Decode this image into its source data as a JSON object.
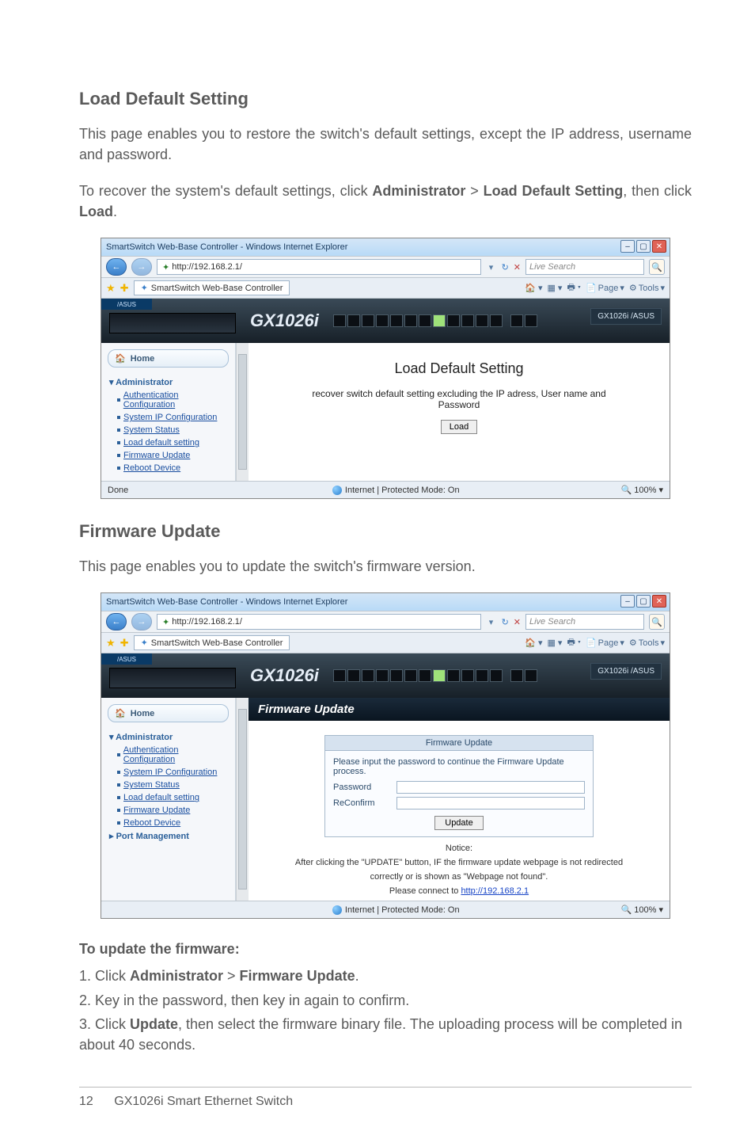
{
  "sections": {
    "load_default": {
      "heading": "Load Default Setting",
      "p1_a": "This page enables you to restore the switch's default settings, except the IP address, username and password.",
      "p2_pre": "To recover the system's default settings, click ",
      "p2_b1": "Administrator",
      "p2_gt": " > ",
      "p2_b2": "Load Default Setting",
      "p2_mid": ", then click ",
      "p2_b3": "Load",
      "p2_end": "."
    },
    "firmware_update": {
      "heading": "Firmware Update",
      "p1": "This page enables you to update the switch's firmware version.",
      "sub": "To update the firmware:",
      "step1_pre": "1. Click ",
      "step1_b1": "Administrator",
      "step1_gt": " > ",
      "step1_b2": "Firmware Update",
      "step1_end": ".",
      "step2": "2.  Key in the password, then key in again to confirm.",
      "step3_pre": "3. Click ",
      "step3_b": "Update",
      "step3_end": ", then select the firmware binary file. The uploading process will be completed in about 40 seconds."
    }
  },
  "screenshot_common": {
    "window_title": "SmartSwitch Web-Base Controller - Windows Internet Explorer",
    "url": "http://192.168.2.1/",
    "search_placeholder": "Live Search",
    "tab_title": "SmartSwitch Web-Base Controller",
    "tool_page": "Page",
    "tool_tools": "Tools",
    "brand_logo": "GX1026i",
    "brand_box": "GX1026i /ASUS",
    "asus_mini": "/ASUS",
    "home_label": "Home",
    "nav_admin": "Administrator",
    "nav_auth": "Authentication Configuration",
    "nav_sysip": "System IP Configuration",
    "nav_status": "System Status",
    "nav_load": "Load default setting",
    "nav_fw": "Firmware Update",
    "nav_reboot": "Reboot Device",
    "nav_port": "Port Management",
    "status_done": "Done",
    "status_mode": "Internet | Protected Mode: On",
    "status_zoom": "100%"
  },
  "shot1": {
    "title": "Load Default Setting",
    "line1": "recover switch default setting excluding the IP adress, User name and",
    "line2": "Password",
    "button": "Load"
  },
  "shot2": {
    "header": "Firmware Update",
    "panel_title": "Firmware Update",
    "instr": "Please input the password to continue the Firmware Update process.",
    "lbl_pass": "Password",
    "lbl_reconf": "ReConfirm",
    "update_btn": "Update",
    "notice_label": "Notice:",
    "notice_line1": "After clicking the \"UPDATE\" button, IF the firmware update webpage is not redirected",
    "notice_line2": "correctly or is shown as \"Webpage not found\".",
    "notice_line3_pre": "Please connect to ",
    "notice_link": "http://192.168.2.1"
  },
  "footer": {
    "page": "12",
    "product": "GX1026i Smart Ethernet Switch"
  }
}
